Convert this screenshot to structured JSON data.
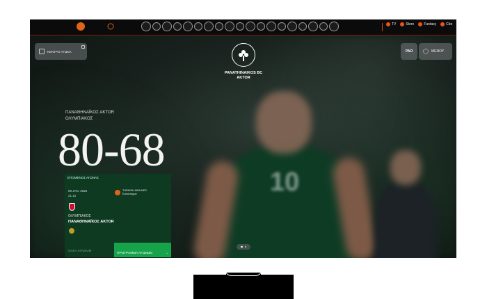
{
  "topbar": {
    "external_links": [
      {
        "label": "TV"
      },
      {
        "label": "Store"
      },
      {
        "label": "Fantasy"
      },
      {
        "label": "Cbe"
      }
    ]
  },
  "hero": {
    "match_center_label": "ΚΕΝΤΡΟ ΑΓΩΝΑ",
    "club_name_line1": "PANATHINAIKOS BC",
    "club_name_line2": "AKTOR",
    "pao_label": "PAO",
    "menu_label": "ΜΕΝΟΥ",
    "home_team": "ΠΑΝΑΘΗΝΑΪΚΟΣ AKTOR",
    "away_team": "ΟΛΥΜΠΙΑΚΟΣ",
    "score": "80-68"
  },
  "next_match": {
    "tag": "ΕΠΟΜΕΝΟΣ ΑΓΩΝΑΣ",
    "date": "09 JAN. 2025",
    "time": "21:15",
    "competition_line1": "TURKISH AIRLINES",
    "competition_line2": "EuroLeague",
    "away_team": "ΟΛΥΜΠΙΑΚΟΣ",
    "home_team": "ΠΑΝΑΘΗΝΑΪΚΟΣ AKTOR",
    "venue": "OAKA STADIUM",
    "schedule_button": "ΠΡΟΓΡΑΜΜΑ ΑΓΩΝΩΝ",
    "schedule_arrow": "→"
  },
  "colors": {
    "accent_orange": "#e8541c",
    "card_green": "#0e3a21",
    "button_green": "#16a34a"
  }
}
